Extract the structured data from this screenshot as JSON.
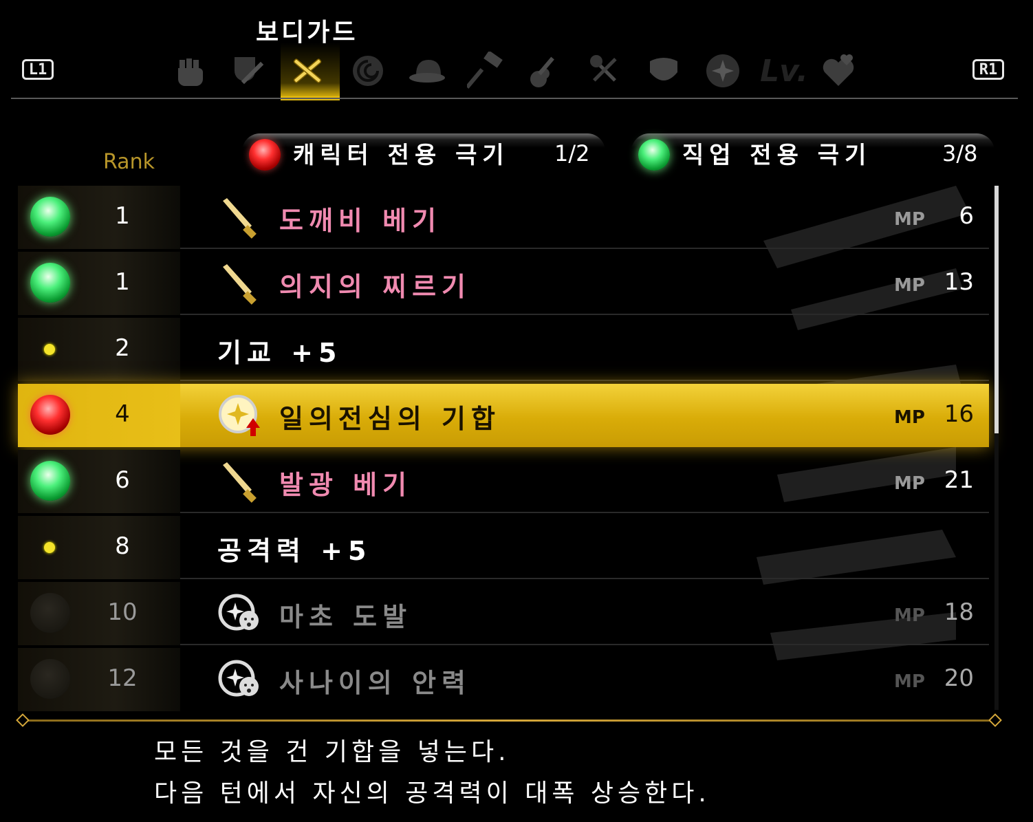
{
  "header": {
    "job_title": "보디가드",
    "left_button": "L1",
    "right_button": "R1",
    "tabs": [
      {
        "icon": "fist-icon"
      },
      {
        "icon": "shield-sword-icon"
      },
      {
        "icon": "crossed-swords-icon",
        "active": true
      },
      {
        "icon": "rose-icon"
      },
      {
        "icon": "hat-icon"
      },
      {
        "icon": "hammer-icon"
      },
      {
        "icon": "guitar-icon"
      },
      {
        "icon": "spatula-fork-icon"
      },
      {
        "icon": "mask-icon"
      },
      {
        "icon": "star-orb-icon"
      },
      {
        "icon": "level-icon",
        "text": "Lv."
      },
      {
        "icon": "hearts-icon"
      }
    ]
  },
  "columns": {
    "rank_label": "Rank",
    "character_skills_label": "캐릭터 전용 극기",
    "character_skills_count": "1/2",
    "job_skills_label": "직업 전용 극기",
    "job_skills_count": "3/8"
  },
  "skills": [
    {
      "orb": "green",
      "rank": "1",
      "icon": "knife-icon",
      "name": "도깨비 베기",
      "name_color": "pink",
      "mp_label": "MP",
      "mp": "6"
    },
    {
      "orb": "green",
      "rank": "1",
      "icon": "knife-icon",
      "name": "의지의 찌르기",
      "name_color": "pink",
      "mp_label": "MP",
      "mp": "13"
    },
    {
      "orb": "dot",
      "rank": "2",
      "icon": "",
      "name": "기교 +5",
      "name_color": "white",
      "mp_label": "",
      "mp": ""
    },
    {
      "orb": "red",
      "rank": "4",
      "icon": "buff-up-icon",
      "name": "일의전심의 기합",
      "name_color": "dark",
      "mp_label": "MP",
      "mp": "16",
      "selected": true
    },
    {
      "orb": "green",
      "rank": "6",
      "icon": "knife-icon",
      "name": "발광 베기",
      "name_color": "pink",
      "mp_label": "MP",
      "mp": "21"
    },
    {
      "orb": "dot",
      "rank": "8",
      "icon": "",
      "name": "공격력 +5",
      "name_color": "white",
      "mp_label": "",
      "mp": ""
    },
    {
      "orb": "dark",
      "rank": "10",
      "icon": "taunt-icon",
      "name": "마초 도발",
      "name_color": "grey",
      "mp_label": "MP",
      "mp": "18"
    },
    {
      "orb": "dark",
      "rank": "12",
      "icon": "taunt-icon",
      "name": "사나이의 안력",
      "name_color": "grey",
      "mp_label": "MP",
      "mp": "20"
    }
  ],
  "description": {
    "line1": "모든 것을 건 기합을 넣는다.",
    "line2": "다음 턴에서 자신의 공격력이 대폭 상승한다."
  },
  "colors": {
    "accent_gold": "#e5bc10",
    "pink_skill": "#f08ab0",
    "rank_label": "#b8962a"
  }
}
